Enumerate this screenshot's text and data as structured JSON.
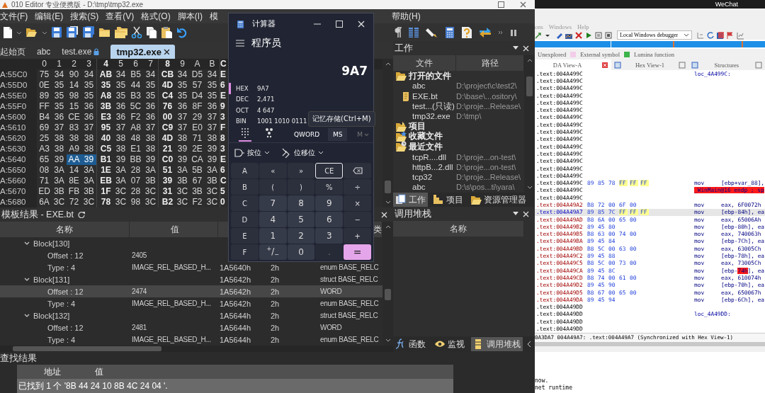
{
  "editor": {
    "title": "010 Editor 专业便携版 - D:\\tmp\\tmp32.exe",
    "menu": {
      "left": [
        "文件(F)",
        "编辑(E)",
        "搜索(S)",
        "查看(V)",
        "格式(O)",
        "脚本(I)",
        "模"
      ],
      "right": [
        "帮助(H)"
      ]
    },
    "tabs": [
      {
        "label": "起始页",
        "selected": false,
        "locked": false,
        "closable": false
      },
      {
        "label": "abc",
        "selected": false,
        "locked": false,
        "closable": false
      },
      {
        "label": "test.exe",
        "selected": false,
        "locked": true,
        "closable": false
      },
      {
        "label": "tmp32.exe",
        "selected": true,
        "locked": false,
        "closable": true
      }
    ],
    "hex": {
      "columns": [
        "0",
        "1",
        "2",
        "3",
        "4",
        "5",
        "6",
        "7",
        "8",
        "9",
        "A",
        "B",
        "C"
      ],
      "rows": [
        {
          "address": "A:55C0",
          "bytes": [
            {
              "value": "75",
              "selected": false
            },
            {
              "value": "34",
              "selected": false
            },
            {
              "value": "90",
              "selected": false
            },
            {
              "value": "34",
              "selected": false
            },
            {
              "value": "AB",
              "selected": false
            },
            {
              "value": "34",
              "selected": false
            },
            {
              "value": "B5",
              "selected": false
            },
            {
              "value": "34",
              "selected": false
            },
            {
              "value": "CB",
              "selected": false
            },
            {
              "value": "34",
              "selected": false
            },
            {
              "value": "D5",
              "selected": false
            },
            {
              "value": "34",
              "selected": false
            },
            {
              "value": "E",
              "selected": false
            }
          ]
        },
        {
          "address": "A:55D0",
          "bytes": [
            {
              "value": "0E",
              "selected": false
            },
            {
              "value": "35",
              "selected": false
            },
            {
              "value": "14",
              "selected": false
            },
            {
              "value": "35",
              "selected": false
            },
            {
              "value": "35",
              "selected": false
            },
            {
              "value": "35",
              "selected": false
            },
            {
              "value": "44",
              "selected": false
            },
            {
              "value": "35",
              "selected": false
            },
            {
              "value": "4D",
              "selected": false
            },
            {
              "value": "35",
              "selected": false
            },
            {
              "value": "57",
              "selected": false
            },
            {
              "value": "35",
              "selected": false
            },
            {
              "value": "6",
              "selected": false
            }
          ]
        },
        {
          "address": "A:55E0",
          "bytes": [
            {
              "value": "89",
              "selected": false
            },
            {
              "value": "35",
              "selected": false
            },
            {
              "value": "98",
              "selected": false
            },
            {
              "value": "35",
              "selected": false
            },
            {
              "value": "A8",
              "selected": false
            },
            {
              "value": "35",
              "selected": false
            },
            {
              "value": "B3",
              "selected": false
            },
            {
              "value": "35",
              "selected": false
            },
            {
              "value": "C4",
              "selected": false
            },
            {
              "value": "35",
              "selected": false
            },
            {
              "value": "D4",
              "selected": false
            },
            {
              "value": "35",
              "selected": false
            },
            {
              "value": "E",
              "selected": false
            }
          ]
        },
        {
          "address": "A:55F0",
          "bytes": [
            {
              "value": "FF",
              "selected": false
            },
            {
              "value": "35",
              "selected": false
            },
            {
              "value": "15",
              "selected": false
            },
            {
              "value": "36",
              "selected": false
            },
            {
              "value": "3B",
              "selected": false
            },
            {
              "value": "36",
              "selected": false
            },
            {
              "value": "5C",
              "selected": false
            },
            {
              "value": "36",
              "selected": false
            },
            {
              "value": "76",
              "selected": false
            },
            {
              "value": "36",
              "selected": false
            },
            {
              "value": "8F",
              "selected": false
            },
            {
              "value": "36",
              "selected": false
            },
            {
              "value": "9",
              "selected": false
            }
          ]
        },
        {
          "address": "A:5600",
          "bytes": [
            {
              "value": "B4",
              "selected": false
            },
            {
              "value": "36",
              "selected": false
            },
            {
              "value": "CE",
              "selected": false
            },
            {
              "value": "36",
              "selected": false
            },
            {
              "value": "E3",
              "selected": false
            },
            {
              "value": "36",
              "selected": false
            },
            {
              "value": "F2",
              "selected": false
            },
            {
              "value": "36",
              "selected": false
            },
            {
              "value": "00",
              "selected": false
            },
            {
              "value": "37",
              "selected": false
            },
            {
              "value": "29",
              "selected": false
            },
            {
              "value": "37",
              "selected": false
            },
            {
              "value": "3",
              "selected": false
            }
          ]
        },
        {
          "address": "A:5610",
          "bytes": [
            {
              "value": "69",
              "selected": false
            },
            {
              "value": "37",
              "selected": false
            },
            {
              "value": "83",
              "selected": false
            },
            {
              "value": "37",
              "selected": false
            },
            {
              "value": "95",
              "selected": false
            },
            {
              "value": "37",
              "selected": false
            },
            {
              "value": "A8",
              "selected": false
            },
            {
              "value": "37",
              "selected": false
            },
            {
              "value": "C9",
              "selected": false
            },
            {
              "value": "37",
              "selected": false
            },
            {
              "value": "E0",
              "selected": false
            },
            {
              "value": "37",
              "selected": false
            },
            {
              "value": "F",
              "selected": false
            }
          ]
        },
        {
          "address": "A:5620",
          "bytes": [
            {
              "value": "25",
              "selected": false
            },
            {
              "value": "38",
              "selected": false
            },
            {
              "value": "38",
              "selected": false
            },
            {
              "value": "38",
              "selected": false
            },
            {
              "value": "40",
              "selected": false
            },
            {
              "value": "38",
              "selected": false
            },
            {
              "value": "48",
              "selected": false
            },
            {
              "value": "38",
              "selected": false
            },
            {
              "value": "4D",
              "selected": false
            },
            {
              "value": "38",
              "selected": false
            },
            {
              "value": "71",
              "selected": false
            },
            {
              "value": "38",
              "selected": false
            },
            {
              "value": "8",
              "selected": false
            }
          ]
        },
        {
          "address": "A:5630",
          "bytes": [
            {
              "value": "A3",
              "selected": false
            },
            {
              "value": "38",
              "selected": false
            },
            {
              "value": "A9",
              "selected": false
            },
            {
              "value": "38",
              "selected": false
            },
            {
              "value": "C5",
              "selected": false
            },
            {
              "value": "38",
              "selected": false
            },
            {
              "value": "E1",
              "selected": false
            },
            {
              "value": "38",
              "selected": false
            },
            {
              "value": "21",
              "selected": false
            },
            {
              "value": "39",
              "selected": false
            },
            {
              "value": "2E",
              "selected": false
            },
            {
              "value": "39",
              "selected": false
            },
            {
              "value": "3",
              "selected": false
            }
          ]
        },
        {
          "address": "A:5640",
          "bytes": [
            {
              "value": "65",
              "selected": false
            },
            {
              "value": "39",
              "selected": false
            },
            {
              "value": "AA",
              "selected": true
            },
            {
              "value": "39",
              "selected": true
            },
            {
              "value": "B1",
              "selected": false
            },
            {
              "value": "39",
              "selected": false
            },
            {
              "value": "BB",
              "selected": false
            },
            {
              "value": "39",
              "selected": false
            },
            {
              "value": "C0",
              "selected": false
            },
            {
              "value": "39",
              "selected": false
            },
            {
              "value": "CA",
              "selected": false
            },
            {
              "value": "39",
              "selected": false
            },
            {
              "value": "E",
              "selected": false
            }
          ]
        },
        {
          "address": "A:5650",
          "bytes": [
            {
              "value": "08",
              "selected": false
            },
            {
              "value": "3A",
              "selected": false
            },
            {
              "value": "14",
              "selected": false
            },
            {
              "value": "3A",
              "selected": false
            },
            {
              "value": "1E",
              "selected": false
            },
            {
              "value": "3A",
              "selected": false
            },
            {
              "value": "28",
              "selected": false
            },
            {
              "value": "3A",
              "selected": false
            },
            {
              "value": "51",
              "selected": false
            },
            {
              "value": "3A",
              "selected": false
            },
            {
              "value": "5B",
              "selected": false
            },
            {
              "value": "3A",
              "selected": false
            },
            {
              "value": "6",
              "selected": false
            }
          ]
        },
        {
          "address": "A:5660",
          "bytes": [
            {
              "value": "71",
              "selected": false
            },
            {
              "value": "3A",
              "selected": false
            },
            {
              "value": "8E",
              "selected": false
            },
            {
              "value": "3A",
              "selected": false
            },
            {
              "value": "EB",
              "selected": false
            },
            {
              "value": "3A",
              "selected": false
            },
            {
              "value": "07",
              "selected": false
            },
            {
              "value": "3B",
              "selected": false
            },
            {
              "value": "39",
              "selected": false
            },
            {
              "value": "3B",
              "selected": false
            },
            {
              "value": "67",
              "selected": false
            },
            {
              "value": "3B",
              "selected": false
            },
            {
              "value": "C",
              "selected": false
            }
          ]
        },
        {
          "address": "A:5670",
          "bytes": [
            {
              "value": "ED",
              "selected": false
            },
            {
              "value": "3B",
              "selected": false
            },
            {
              "value": "FB",
              "selected": false
            },
            {
              "value": "3B",
              "selected": false
            },
            {
              "value": "1F",
              "selected": false
            },
            {
              "value": "3C",
              "selected": false
            },
            {
              "value": "28",
              "selected": false
            },
            {
              "value": "3C",
              "selected": false
            },
            {
              "value": "31",
              "selected": false
            },
            {
              "value": "3C",
              "selected": false
            },
            {
              "value": "3B",
              "selected": false
            },
            {
              "value": "3C",
              "selected": false
            },
            {
              "value": "5",
              "selected": false
            }
          ]
        },
        {
          "address": "A:5680",
          "bytes": [
            {
              "value": "6A",
              "selected": false
            },
            {
              "value": "3C",
              "selected": false
            },
            {
              "value": "72",
              "selected": false
            },
            {
              "value": "3C",
              "selected": false
            },
            {
              "value": "78",
              "selected": false
            },
            {
              "value": "3C",
              "selected": false
            },
            {
              "value": "98",
              "selected": false
            },
            {
              "value": "3C",
              "selected": false
            },
            {
              "value": "B2",
              "selected": false
            },
            {
              "value": "3C",
              "selected": false
            },
            {
              "value": "F2",
              "selected": false
            },
            {
              "value": "3C",
              "selected": false
            },
            {
              "value": "0",
              "selected": false
            }
          ]
        }
      ]
    },
    "template": {
      "title": "模板结果 - EXE.bt",
      "columns": {
        "name": "名称",
        "value": "值",
        "column_5": "类"
      },
      "rows": [
        {
          "name": "Block[130]",
          "expanded": true,
          "selected": false,
          "children": [
            {
              "name": "Offset : 12",
              "value": "2405",
              "selected": false
            },
            {
              "name": "Type : 4",
              "value": "IMAGE_REL_BASED_H...",
              "column_3": "1A5640h",
              "column_4": "2h",
              "column_5": "enum BASE_RELC",
              "selected": false
            }
          ]
        },
        {
          "name": "Block[131]",
          "expanded": true,
          "selected": false,
          "column_3": "1A5642h",
          "column_4": "2h",
          "column_5": "struct BASE_RELC",
          "children": [
            {
              "name": "Offset : 12",
              "value": "2474",
              "column_3": "1A5642h",
              "column_4": "2h",
              "column_5": "WORD",
              "selected": true
            },
            {
              "name": "Type : 4",
              "value": "IMAGE_REL_BASED_H...",
              "column_3": "1A5642h",
              "column_4": "2h",
              "column_5": "enum BASE_RELC",
              "selected": false
            }
          ]
        },
        {
          "name": "Block[132]",
          "expanded": true,
          "selected": false,
          "column_3": "1A5644h",
          "column_4": "2h",
          "column_5": "struct BASE_RELC",
          "children": [
            {
              "name": "Offset : 12",
              "value": "2481",
              "column_3": "1A5644h",
              "column_4": "2h",
              "column_5": "WORD",
              "selected": false
            },
            {
              "name": "Type : 4",
              "value": "IMAGE_REL_BASED_H...",
              "column_3": "1A5644h",
              "column_4": "2h",
              "column_5": "enum BASE_RELC",
              "selected": false
            }
          ]
        }
      ]
    },
    "work": {
      "title": "工作",
      "columns": [
        "文件",
        "路径"
      ],
      "groups": [
        {
          "name": "打开的文件",
          "kind": "open",
          "items": [
            {
              "name": "abc",
              "path": "D:\\project\\c\\test2\\",
              "kind": "file"
            },
            {
              "name": "EXE.bt",
              "path": "D:\\base\\...ository\\",
              "kind": "script"
            },
            {
              "name": "test...(只读)",
              "path": "D:\\proje...Release\\",
              "kind": "file"
            },
            {
              "name": "tmp32.exe",
              "path": "D:\\tmp\\",
              "kind": "file"
            }
          ]
        },
        {
          "name": "项目",
          "kind": "project"
        },
        {
          "name": "收藏文件",
          "kind": "favorites"
        },
        {
          "name": "最近文件",
          "kind": "recent",
          "items": [
            {
              "name": "tcpR....dll",
              "path": "D:\\proje...on-test\\",
              "kind": "file"
            },
            {
              "name": "httpB...2.dll",
              "path": "D:\\proje...on-test\\",
              "kind": "file"
            },
            {
              "name": "tcp32",
              "path": "D:\\proje...Release\\",
              "kind": "file"
            },
            {
              "name": "abc",
              "path": "D:\\s\\pos...ti\\yara\\",
              "kind": "file"
            }
          ]
        }
      ],
      "tabs": [
        {
          "label": "工作",
          "kind": "work",
          "selected": true
        },
        {
          "label": "项目",
          "kind": "project",
          "selected": false
        },
        {
          "label": "资源管理器",
          "kind": "explorer",
          "selected": false
        }
      ]
    },
    "call_stack": {
      "title": "调用堆栈",
      "columns": [
        "名称"
      ]
    },
    "bottom_tabs": [
      {
        "label": "函数",
        "kind": "function",
        "selected": false
      },
      {
        "label": "监视",
        "kind": "watch",
        "selected": false
      },
      {
        "label": "调用堆栈",
        "kind": "stack",
        "selected": true
      }
    ],
    "find": {
      "title": "查找结果",
      "columns": [
        "地址",
        "值"
      ],
      "rows": [
        "已找到 1 个 '8B 44 24 10 8B 4C 24 04 '."
      ]
    }
  },
  "calculator": {
    "title": "计算器",
    "mode": "程序员",
    "display": "9A7",
    "radix": [
      {
        "label": "HEX",
        "value": "9A7",
        "selected": true
      },
      {
        "label": "DEC",
        "value": "2,471",
        "selected": false
      },
      {
        "label": "OCT",
        "value": "4 647",
        "selected": false
      },
      {
        "label": "BIN",
        "value": "1001 1010 0111",
        "selected": false
      }
    ],
    "tooltip": "记忆存储(Ctrl+M)",
    "views": [
      {
        "kind": "keypad",
        "selected": true
      },
      {
        "kind": "bits",
        "selected": false
      }
    ],
    "word_size": "QWORD",
    "memory": [
      {
        "label": "MS",
        "disabled": false
      },
      {
        "label": "M",
        "disabled": true
      }
    ],
    "menus": [
      {
        "label": "按位",
        "kind": "bitwise"
      },
      {
        "label": "位移位",
        "kind": "shift"
      }
    ],
    "keys": [
      {
        "label": "A",
        "kind": "letter",
        "disabled": false,
        "focused": false
      },
      {
        "label": "«",
        "kind": "op",
        "disabled": false,
        "focused": false
      },
      {
        "label": "»",
        "kind": "op",
        "disabled": false,
        "focused": false
      },
      {
        "label": "CE",
        "kind": "op",
        "disabled": false,
        "focused": true
      },
      {
        "kind": "backspace",
        "disabled": false,
        "focused": false
      },
      {
        "label": "B",
        "kind": "letter",
        "disabled": false,
        "focused": false
      },
      {
        "label": "(",
        "kind": "op",
        "disabled": false,
        "focused": false
      },
      {
        "label": ")",
        "kind": "op",
        "disabled": false,
        "focused": false
      },
      {
        "label": "%",
        "kind": "op",
        "disabled": false,
        "focused": false
      },
      {
        "label": "÷",
        "kind": "op",
        "disabled": false,
        "focused": false
      },
      {
        "label": "C",
        "kind": "letter",
        "disabled": false,
        "focused": false
      },
      {
        "label": "7",
        "kind": "digit",
        "disabled": false,
        "focused": false
      },
      {
        "label": "8",
        "kind": "digit",
        "disabled": false,
        "focused": false
      },
      {
        "label": "9",
        "kind": "digit",
        "disabled": false,
        "focused": false
      },
      {
        "label": "×",
        "kind": "op",
        "disabled": false,
        "focused": false
      },
      {
        "label": "D",
        "kind": "letter",
        "disabled": false,
        "focused": false
      },
      {
        "label": "4",
        "kind": "digit",
        "disabled": false,
        "focused": false
      },
      {
        "label": "5",
        "kind": "digit",
        "disabled": false,
        "focused": false
      },
      {
        "label": "6",
        "kind": "digit",
        "disabled": false,
        "focused": false
      },
      {
        "label": "−",
        "kind": "op",
        "disabled": false,
        "focused": false
      },
      {
        "label": "E",
        "kind": "letter",
        "disabled": false,
        "focused": false
      },
      {
        "label": "1",
        "kind": "digit",
        "disabled": false,
        "focused": false
      },
      {
        "label": "2",
        "kind": "digit",
        "disabled": false,
        "focused": false
      },
      {
        "label": "3",
        "kind": "digit",
        "disabled": false,
        "focused": false
      },
      {
        "label": "+",
        "kind": "op",
        "disabled": false,
        "focused": false
      },
      {
        "label": "F",
        "kind": "letter",
        "disabled": false,
        "focused": false
      },
      {
        "label": "$^{+}$/$_{−}$",
        "kind": "digit",
        "disabled": false,
        "focused": false
      },
      {
        "label": "0",
        "kind": "digit",
        "disabled": false,
        "focused": false
      },
      {
        "label": ".",
        "kind": "digit",
        "disabled": true,
        "focused": false
      },
      {
        "label": "=",
        "kind": "equals",
        "disabled": false,
        "focused": false
      }
    ]
  },
  "ida": {
    "taskbar": "WeChat",
    "menu": [
      "ons",
      "Windows",
      "Help"
    ],
    "debugger": "Local Windows debugger",
    "legend": [
      {
        "label": "Unexplored"
      },
      {
        "label": "External symbol",
        "color": "#f2cdea"
      },
      {
        "label": "Lumina function",
        "color": "#3cb44b"
      }
    ],
    "tabs": [
      {
        "label": "DA View-A",
        "selected": true
      },
      {
        "label": "Hex View-1",
        "selected": false
      },
      {
        "label": "Structures",
        "selected": false
      }
    ],
    "lines": [
      {
        "address": ".text:004A499C",
        "kind": "label",
        "selected": false,
        "label": "loc_4A499C:"
      },
      {
        "address": ".text:004A499C",
        "kind": "plain",
        "selected": false
      },
      {
        "address": ".text:004A499C",
        "kind": "plain",
        "selected": false
      },
      {
        "address": ".text:004A499C",
        "kind": "plain",
        "selected": false
      },
      {
        "address": ".text:004A499C",
        "kind": "plain",
        "selected": false
      },
      {
        "address": ".text:004A499C",
        "kind": "plain",
        "selected": false
      },
      {
        "address": ".text:004A499C",
        "kind": "plain",
        "selected": false
      },
      {
        "address": ".text:004A499C",
        "kind": "plain",
        "selected": false
      },
      {
        "address": ".text:004A499C",
        "kind": "plain",
        "selected": false
      },
      {
        "address": ".text:004A499C",
        "kind": "plain",
        "selected": false
      },
      {
        "address": ".text:004A499C",
        "kind": "plain",
        "selected": false
      },
      {
        "address": ".text:004A499C",
        "kind": "plain",
        "selected": false
      },
      {
        "address": ".text:004A499C",
        "kind": "plain",
        "selected": false
      },
      {
        "address": ".text:004A499C",
        "kind": "plain",
        "selected": false
      },
      {
        "address": ".text:004A499C",
        "kind": "plain",
        "selected": false
      },
      {
        "address": ".text:004A499C",
        "kind": "plain",
        "selected": false,
        "bytes": [
          {
            "value": "89",
            "highlighted": false
          },
          {
            "value": "85",
            "highlighted": false
          },
          {
            "value": "78",
            "highlighted": false
          },
          {
            "value": "FF",
            "highlighted": true
          },
          {
            "value": "FF",
            "highlighted": true
          },
          {
            "value": "FF",
            "highlighted": true
          }
        ],
        "mnemonic": "mov",
        "operands": [
          {
            "text": "[ebp+var_88],",
            "highlighted": false
          }
        ]
      },
      {
        "address": ".text:004A499C",
        "kind": "endp",
        "selected": false,
        "label": "_WinMain@16 endp ; sp"
      },
      {
        "address": ".text:004A499C",
        "kind": "plain",
        "selected": false
      },
      {
        "address": ".text:004A49A2",
        "kind": "code",
        "selected": false,
        "bytes": [
          {
            "value": "B8",
            "highlighted": false
          },
          {
            "value": "72",
            "highlighted": false
          },
          {
            "value": "00",
            "highlighted": false
          },
          {
            "value": "6F",
            "highlighted": false
          },
          {
            "value": "00",
            "highlighted": false
          }
        ],
        "mnemonic": "mov",
        "operands": [
          {
            "text": "eax, 6F0072h",
            "highlighted": false
          }
        ]
      },
      {
        "address": ".text:004A49A7",
        "kind": "code",
        "selected": true,
        "bytes": [
          {
            "value": "89",
            "highlighted": false
          },
          {
            "value": "85",
            "highlighted": false
          },
          {
            "value": "7C",
            "highlighted": false
          },
          {
            "value": "FF",
            "highlighted": true
          },
          {
            "value": "FF",
            "highlighted": true
          },
          {
            "value": "FF",
            "highlighted": true
          }
        ],
        "mnemonic": "mov",
        "operands": [
          {
            "text": "[ebp-84h], ea",
            "highlighted": false
          }
        ]
      },
      {
        "address": ".text:004A49AD",
        "kind": "code",
        "selected": false,
        "bytes": [
          {
            "value": "B8",
            "highlighted": false
          },
          {
            "value": "6A",
            "highlighted": false
          },
          {
            "value": "00",
            "highlighted": false
          },
          {
            "value": "65",
            "highlighted": false
          },
          {
            "value": "00",
            "highlighted": false
          }
        ],
        "mnemonic": "mov",
        "operands": [
          {
            "text": "eax, 65006Ah",
            "highlighted": false
          }
        ]
      },
      {
        "address": ".text:004A49B2",
        "kind": "code",
        "selected": false,
        "bytes": [
          {
            "value": "89",
            "highlighted": false
          },
          {
            "value": "45",
            "highlighted": false
          },
          {
            "value": "80",
            "highlighted": false
          }
        ],
        "mnemonic": "mov",
        "operands": [
          {
            "text": "[ebp-80h], ea",
            "highlighted": false
          }
        ]
      },
      {
        "address": ".text:004A49B5",
        "kind": "code",
        "selected": false,
        "bytes": [
          {
            "value": "B8",
            "highlighted": false
          },
          {
            "value": "63",
            "highlighted": false
          },
          {
            "value": "00",
            "highlighted": false
          },
          {
            "value": "74",
            "highlighted": false
          },
          {
            "value": "00",
            "highlighted": false
          }
        ],
        "mnemonic": "mov",
        "operands": [
          {
            "text": "eax, 740063h",
            "highlighted": false
          }
        ]
      },
      {
        "address": ".text:004A49BA",
        "kind": "code",
        "selected": false,
        "bytes": [
          {
            "value": "89",
            "highlighted": false
          },
          {
            "value": "45",
            "highlighted": false
          },
          {
            "value": "84",
            "highlighted": false
          }
        ],
        "mnemonic": "mov",
        "operands": [
          {
            "text": "[ebp-7Ch], ea",
            "highlighted": false
          }
        ]
      },
      {
        "address": ".text:004A49BD",
        "kind": "code",
        "selected": false,
        "bytes": [
          {
            "value": "B8",
            "highlighted": false
          },
          {
            "value": "5C",
            "highlighted": false
          },
          {
            "value": "00",
            "highlighted": false
          },
          {
            "value": "63",
            "highlighted": false
          },
          {
            "value": "00",
            "highlighted": false
          }
        ],
        "mnemonic": "mov",
        "operands": [
          {
            "text": "eax, 63005Ch",
            "highlighted": false
          }
        ]
      },
      {
        "address": ".text:004A49C2",
        "kind": "code",
        "selected": false,
        "bytes": [
          {
            "value": "89",
            "highlighted": false
          },
          {
            "value": "45",
            "highlighted": false
          },
          {
            "value": "88",
            "highlighted": false
          }
        ],
        "mnemonic": "mov",
        "operands": [
          {
            "text": "[ebp-78h], ea",
            "highlighted": false
          }
        ]
      },
      {
        "address": ".text:004A49C5",
        "kind": "code",
        "selected": false,
        "bytes": [
          {
            "value": "B8",
            "highlighted": false
          },
          {
            "value": "5C",
            "highlighted": false
          },
          {
            "value": "00",
            "highlighted": false
          },
          {
            "value": "73",
            "highlighted": false
          },
          {
            "value": "00",
            "highlighted": false
          }
        ],
        "mnemonic": "mov",
        "operands": [
          {
            "text": "eax, 73005Ch",
            "highlighted": false
          }
        ]
      },
      {
        "address": ".text:004A49CA",
        "kind": "code",
        "selected": false,
        "bytes": [
          {
            "value": "89",
            "highlighted": false
          },
          {
            "value": "45",
            "highlighted": false
          },
          {
            "value": "8C",
            "highlighted": false
          }
        ],
        "mnemonic": "mov",
        "operands": [
          {
            "text": "[ebp-",
            "highlighted": false
          },
          {
            "text": "74h",
            "highlighted": true
          },
          {
            "text": "], ea",
            "highlighted": false
          }
        ]
      },
      {
        "address": ".text:004A49CD",
        "kind": "code",
        "selected": false,
        "bytes": [
          {
            "value": "B8",
            "highlighted": false
          },
          {
            "value": "74",
            "highlighted": false
          },
          {
            "value": "00",
            "highlighted": false
          },
          {
            "value": "61",
            "highlighted": false
          },
          {
            "value": "00",
            "highlighted": false
          }
        ],
        "mnemonic": "mov",
        "operands": [
          {
            "text": "eax, 610074h",
            "highlighted": false
          }
        ]
      },
      {
        "address": ".text:004A49D2",
        "kind": "code",
        "selected": false,
        "bytes": [
          {
            "value": "89",
            "highlighted": false
          },
          {
            "value": "45",
            "highlighted": false
          },
          {
            "value": "90",
            "highlighted": false
          }
        ],
        "mnemonic": "mov",
        "operands": [
          {
            "text": "[ebp-70h], ea",
            "highlighted": false
          }
        ]
      },
      {
        "address": ".text:004A49D5",
        "kind": "code",
        "selected": false,
        "bytes": [
          {
            "value": "B8",
            "highlighted": false
          },
          {
            "value": "67",
            "highlighted": false
          },
          {
            "value": "00",
            "highlighted": false
          },
          {
            "value": "65",
            "highlighted": false
          },
          {
            "value": "00",
            "highlighted": false
          }
        ],
        "mnemonic": "mov",
        "operands": [
          {
            "text": "eax, 650067h",
            "highlighted": false
          }
        ]
      },
      {
        "address": ".text:004A49DA",
        "kind": "code",
        "selected": false,
        "bytes": [
          {
            "value": "89",
            "highlighted": false
          },
          {
            "value": "45",
            "highlighted": false
          },
          {
            "value": "94",
            "highlighted": false
          }
        ],
        "mnemonic": "mov",
        "operands": [
          {
            "text": "[ebp-6Ch], ea",
            "highlighted": false
          }
        ]
      },
      {
        "address": ".text:004A49DD",
        "kind": "plain",
        "selected": false
      },
      {
        "address": ".text:004A49DD",
        "kind": "label",
        "selected": false,
        "label": "loc_4A49DD:"
      },
      {
        "address": ".text:004A49DD",
        "kind": "plain",
        "selected": false
      },
      {
        "address": ".text:004A49DD",
        "kind": "plain",
        "selected": false
      }
    ],
    "status": "0A3DA7 004A49A7: .text:004A49A7 (Synchronized with Hex View-1)",
    "output": [
      "now.",
      "net runtime"
    ]
  }
}
